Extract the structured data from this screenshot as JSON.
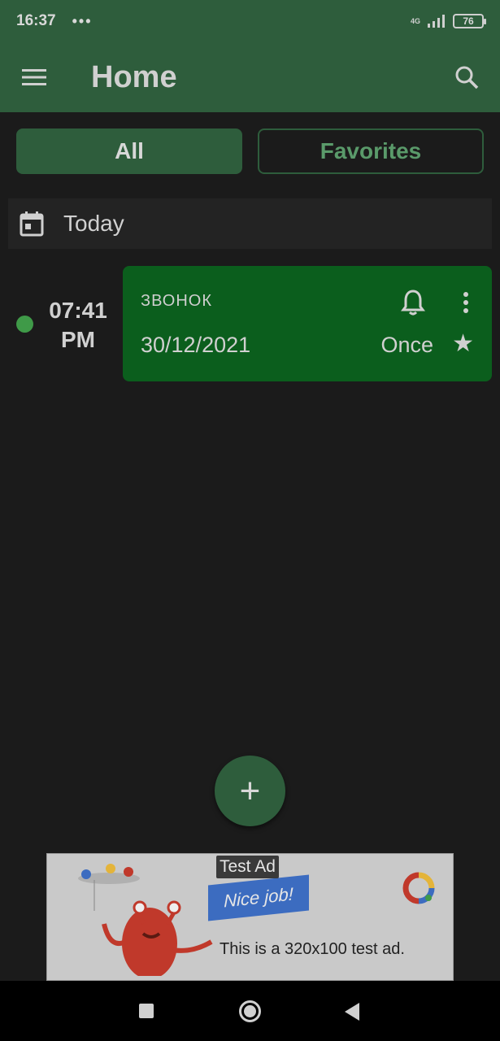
{
  "status_bar": {
    "time": "16:37",
    "dots": "•••",
    "network": "4G",
    "battery": "76"
  },
  "app_bar": {
    "title": "Home"
  },
  "filters": {
    "all": "All",
    "favorites": "Favorites"
  },
  "section": {
    "label": "Today"
  },
  "alarm": {
    "time_line1": "07:41",
    "time_line2": "PM",
    "name": "ЗВОНОК",
    "date": "30/12/2021",
    "repeat": "Once",
    "favorite_symbol": "★"
  },
  "fab": {
    "symbol": "+"
  },
  "ad": {
    "label": "Test Ad",
    "banner": "Nice job!",
    "text": "This is a 320x100 test ad."
  },
  "colors": {
    "primary": "#2e5d3c",
    "card": "#0b5e1d",
    "status_dot": "#3f9a48",
    "background": "#1b1b1b"
  }
}
